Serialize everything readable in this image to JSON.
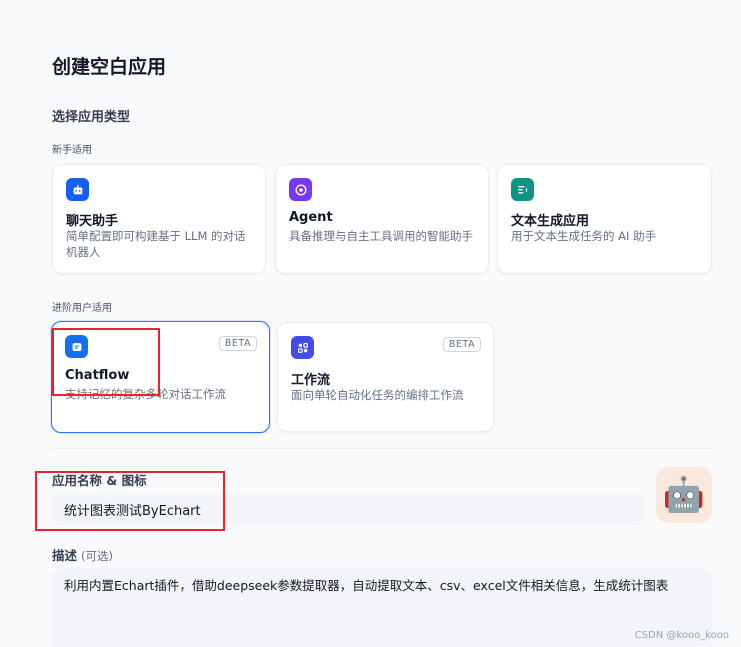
{
  "page_title": "创建空白应用",
  "app_type_section": "选择应用类型",
  "groups": {
    "beginner": "新手适用",
    "advanced": "进阶用户适用"
  },
  "beginner_cards": [
    {
      "name": "聊天助手",
      "desc": "简单配置即可构建基于 LLM 的对话机器人",
      "icon": "chat-bot-icon",
      "color": "#155eef"
    },
    {
      "name": "Agent",
      "desc": "具备推理与自主工具调用的智能助手",
      "icon": "agent-icon",
      "color": "#7839ee"
    },
    {
      "name": "文本生成应用",
      "desc": "用于文本生成任务的 AI 助手",
      "icon": "text-generation-icon",
      "color": "#0e9384"
    }
  ],
  "advanced_cards": [
    {
      "name": "Chatflow",
      "desc": "支持记忆的复杂多轮对话工作流",
      "badge": "BETA",
      "icon": "chatflow-icon",
      "color": "#1570ef",
      "selected": true
    },
    {
      "name": "工作流",
      "desc": "面向单轮自动化任务的编排工作流",
      "badge": "BETA",
      "icon": "workflow-icon",
      "color": "#444ce7"
    }
  ],
  "name_field": {
    "label": "应用名称 & 图标",
    "value": "统计图表测试ByEchart"
  },
  "avatar": {
    "emoji": "🤖",
    "background": "#fbe8dc"
  },
  "description_field": {
    "label": "描述",
    "optional": "(可选)",
    "value": "利用内置Echart插件，借助deepseek参数提取器，自动提取文本、csv、excel文件相关信息，生成统计图表"
  },
  "watermark": "CSDN @kooo_kooo",
  "accent_color": "#2970ff",
  "highlight_color": "#e5242b"
}
